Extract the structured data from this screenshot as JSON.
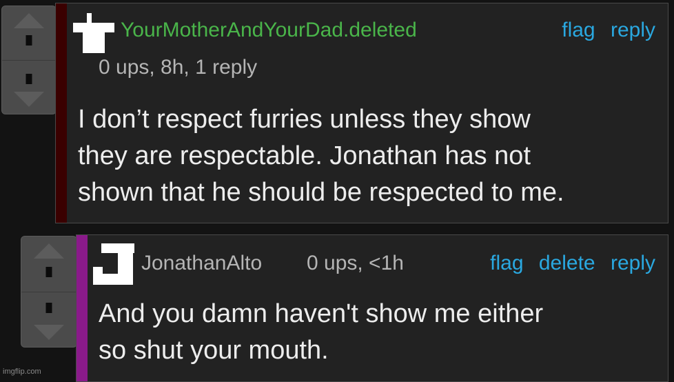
{
  "comments": [
    {
      "username": "YourMotherAndYourDad.deleted",
      "meta": "0 ups, 8h, 1 reply",
      "actions": {
        "flag": "flag",
        "reply": "reply"
      },
      "body_lines": [
        "I don’t respect furries unless they show",
        "they are respectable. Jonathan has not",
        "shown that he should be respected to me."
      ],
      "username_color": "#4ab54a",
      "bar_color": "#3a0000"
    },
    {
      "username": "JonathanAlto",
      "meta": "0 ups, <1h",
      "actions": {
        "flag": "flag",
        "delete": "delete",
        "reply": "reply"
      },
      "body_lines": [
        "And you damn haven't show me either",
        "so shut your mouth."
      ],
      "username_color": "#b5b5b5",
      "bar_color": "#8a1a8a"
    }
  ],
  "watermark": "imgflip.com",
  "icons": {
    "upvote": "upvote-arrow-icon",
    "downvote": "downvote-arrow-icon",
    "avatar": "user-avatar-icon"
  },
  "colors": {
    "link": "#2aa8e0",
    "text": "#ededed",
    "muted": "#b5b5b5"
  }
}
